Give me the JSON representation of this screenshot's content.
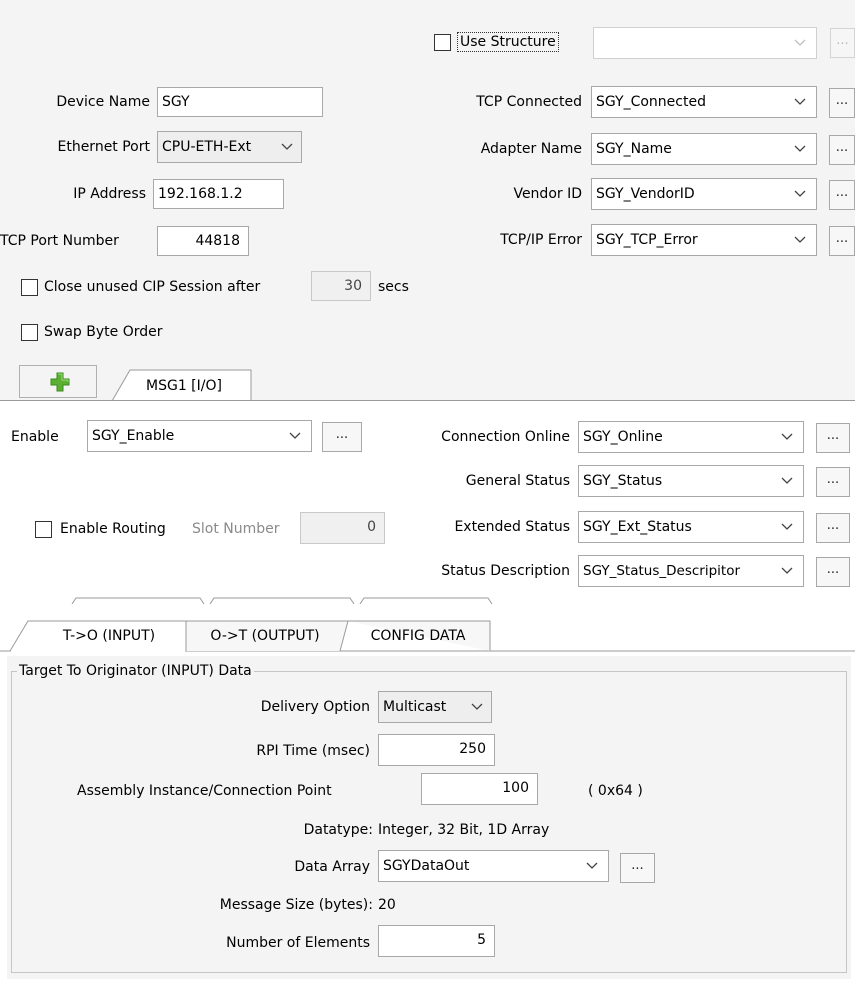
{
  "structure": {
    "use_label": "Use Structure",
    "select_value": "",
    "browse_label": "..."
  },
  "device": {
    "name_label": "Device Name",
    "name_value": "SGY",
    "port_label": "Ethernet Port",
    "port_value": "CPU-ETH-Ext",
    "ip_label": "IP Address",
    "ip_value": "192.168.1.2",
    "tcp_port_label": "TCP Port Number",
    "tcp_port_value": "44818"
  },
  "tags": {
    "tcp_connected_label": "TCP Connected",
    "tcp_connected_value": "SGY_Connected",
    "adapter_name_label": "Adapter Name",
    "adapter_name_value": "SGY_Name",
    "vendor_id_label": "Vendor ID",
    "vendor_id_value": "SGY_VendorID",
    "tcp_error_label": "TCP/IP Error",
    "tcp_error_value": "SGY_TCP_Error",
    "browse_label": "..."
  },
  "session": {
    "close_label": "Close unused CIP Session after",
    "close_value": "30",
    "secs_label": "secs",
    "swap_label": "Swap Byte Order"
  },
  "msg_tabs": {
    "add_icon": "plus-icon",
    "tab_label": "MSG1 [I/O]"
  },
  "msg": {
    "enable_label": "Enable",
    "enable_value": "SGY_Enable",
    "routing_label": "Enable Routing",
    "slot_label": "Slot Number",
    "slot_value": "0",
    "conn_online_label": "Connection Online",
    "conn_online_value": "SGY_Online",
    "general_status_label": "General Status",
    "general_status_value": "SGY_Status",
    "extended_status_label": "Extended Status",
    "extended_status_value": "SGY_Ext_Status",
    "status_desc_label": "Status Description",
    "status_desc_value": "SGY_Status_Descripitor",
    "browse_label": "..."
  },
  "io_tabs": [
    "T->O (INPUT)",
    "O->T (OUTPUT)",
    "CONFIG DATA"
  ],
  "input": {
    "group_title": "Target To Originator (INPUT) Data",
    "delivery_label": "Delivery Option",
    "delivery_value": "Multicast",
    "rpi_label": "RPI Time (msec)",
    "rpi_value": "250",
    "assembly_label": "Assembly Instance/Connection Point",
    "assembly_value": "100",
    "assembly_hex": "( 0x64 )",
    "datatype_label": "Datatype:",
    "datatype_value": "Integer, 32 Bit, 1D Array",
    "data_array_label": "Data Array",
    "data_array_value": "SGYDataOut",
    "msg_size_label": "Message Size (bytes):",
    "msg_size_value": "20",
    "num_elements_label": "Number of Elements",
    "num_elements_value": "5",
    "browse_label": "..."
  },
  "colors": {
    "panel_bg": "#f4f4f4",
    "add_icon": "#5bb033",
    "border": "#a8a8a8"
  }
}
